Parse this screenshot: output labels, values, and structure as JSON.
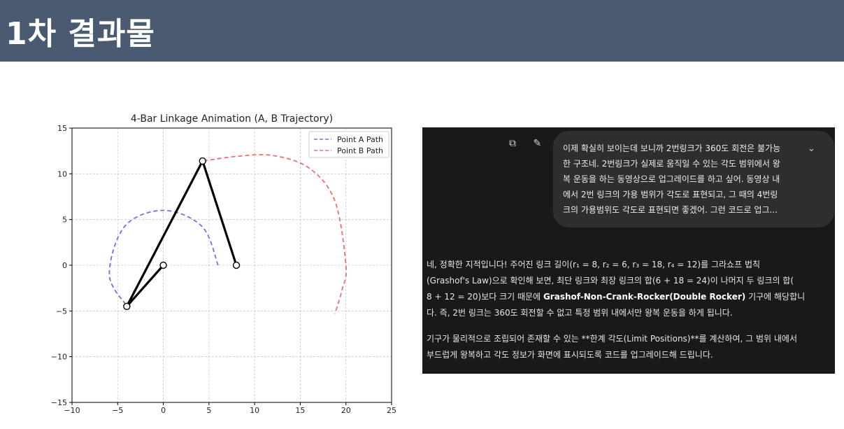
{
  "slide": {
    "title": "1차 결과물"
  },
  "chart_data": {
    "type": "line",
    "title": "4-Bar Linkage Animation (A, B Trajectory)",
    "xlabel": "",
    "ylabel": "",
    "xlim": [
      -10,
      25
    ],
    "ylim": [
      -15,
      15
    ],
    "xticks": [
      -10,
      -5,
      0,
      5,
      10,
      15,
      20,
      25
    ],
    "yticks": [
      -15,
      -10,
      -5,
      0,
      5,
      10,
      15
    ],
    "grid": true,
    "legend_position": "top-right",
    "series": [
      {
        "name": "Point A Path",
        "style": "dashed",
        "color": "#7070ee",
        "x": [
          6.0,
          4.24,
          0.0,
          -4.24,
          -5.91,
          -3.97
        ],
        "y": [
          0.0,
          4.24,
          6.0,
          4.24,
          -1.04,
          -4.5
        ]
      },
      {
        "name": "Point B Path",
        "style": "dashed",
        "color": "#ee7070",
        "x": [
          4.4,
          8.0,
          12.0,
          16.0,
          18.8,
          20.0,
          19.6,
          18.8
        ],
        "y": [
          11.4,
          11.9,
          12.0,
          10.6,
          7.0,
          0.0,
          -2.6,
          -5.3
        ]
      }
    ],
    "linkage": {
      "points_x": [
        0.0,
        -4.0,
        4.3,
        8.0
      ],
      "points_y": [
        0.0,
        -4.5,
        11.4,
        0.0
      ]
    }
  },
  "chat": {
    "copy_icon": "⧉",
    "edit_icon": "✎",
    "chevron_icon": "⌄",
    "user_lines": [
      "이제 확실히 보이는데 보니까 2번링크가 360도 회전은 불가능",
      "한 구조네. 2번링크가 실제로 움직일 수 있는 각도 범위에서 왕",
      "복 운동을 하는 동영상으로 업그레이드를 하고 싶어. 동영상 내",
      "에서 2번 링크의 가용 범위가 각도로 표현되고, 그 때의 4번링",
      "크의 가용범위도 각도로 표현되면 좋겠어. 그런 코드로 업그..."
    ],
    "answer_p1_line1": "네, 정확한 지적입니다! 주어진 링크 길이(r₁ = 8, r₂ = 6, r₃ = 18, r₄ = 12)를 그라쇼프 법칙",
    "answer_p1_line2": "(Grashof's Law)으로 확인해 보면, 최단 링크와 최장 링크의 합(6 + 18 = 24)이 나머지 두 링크의 합(",
    "answer_p1_line3_a": "8 + 12 = 20)보다 크기 때문에 ",
    "answer_p1_line3_b": "Grashof-Non-Crank-Rocker(Double Rocker)",
    "answer_p1_line3_c": " 기구에 해당합니",
    "answer_p1_line4": "다. 즉, 2번 링크는 360도 회전할 수 없고 특정 범위 내에서만 왕복 운동을 하게 됩니다.",
    "answer_p2_line1": "기구가 물리적으로 조립되어 존재할 수 있는 **한계 각도(Limit Positions)**를 계산하여, 그 범위 내에서",
    "answer_p2_line2": "부드럽게 왕복하고 각도 정보가 화면에 표시되도록 코드를 업그레이드해 드립니다."
  }
}
